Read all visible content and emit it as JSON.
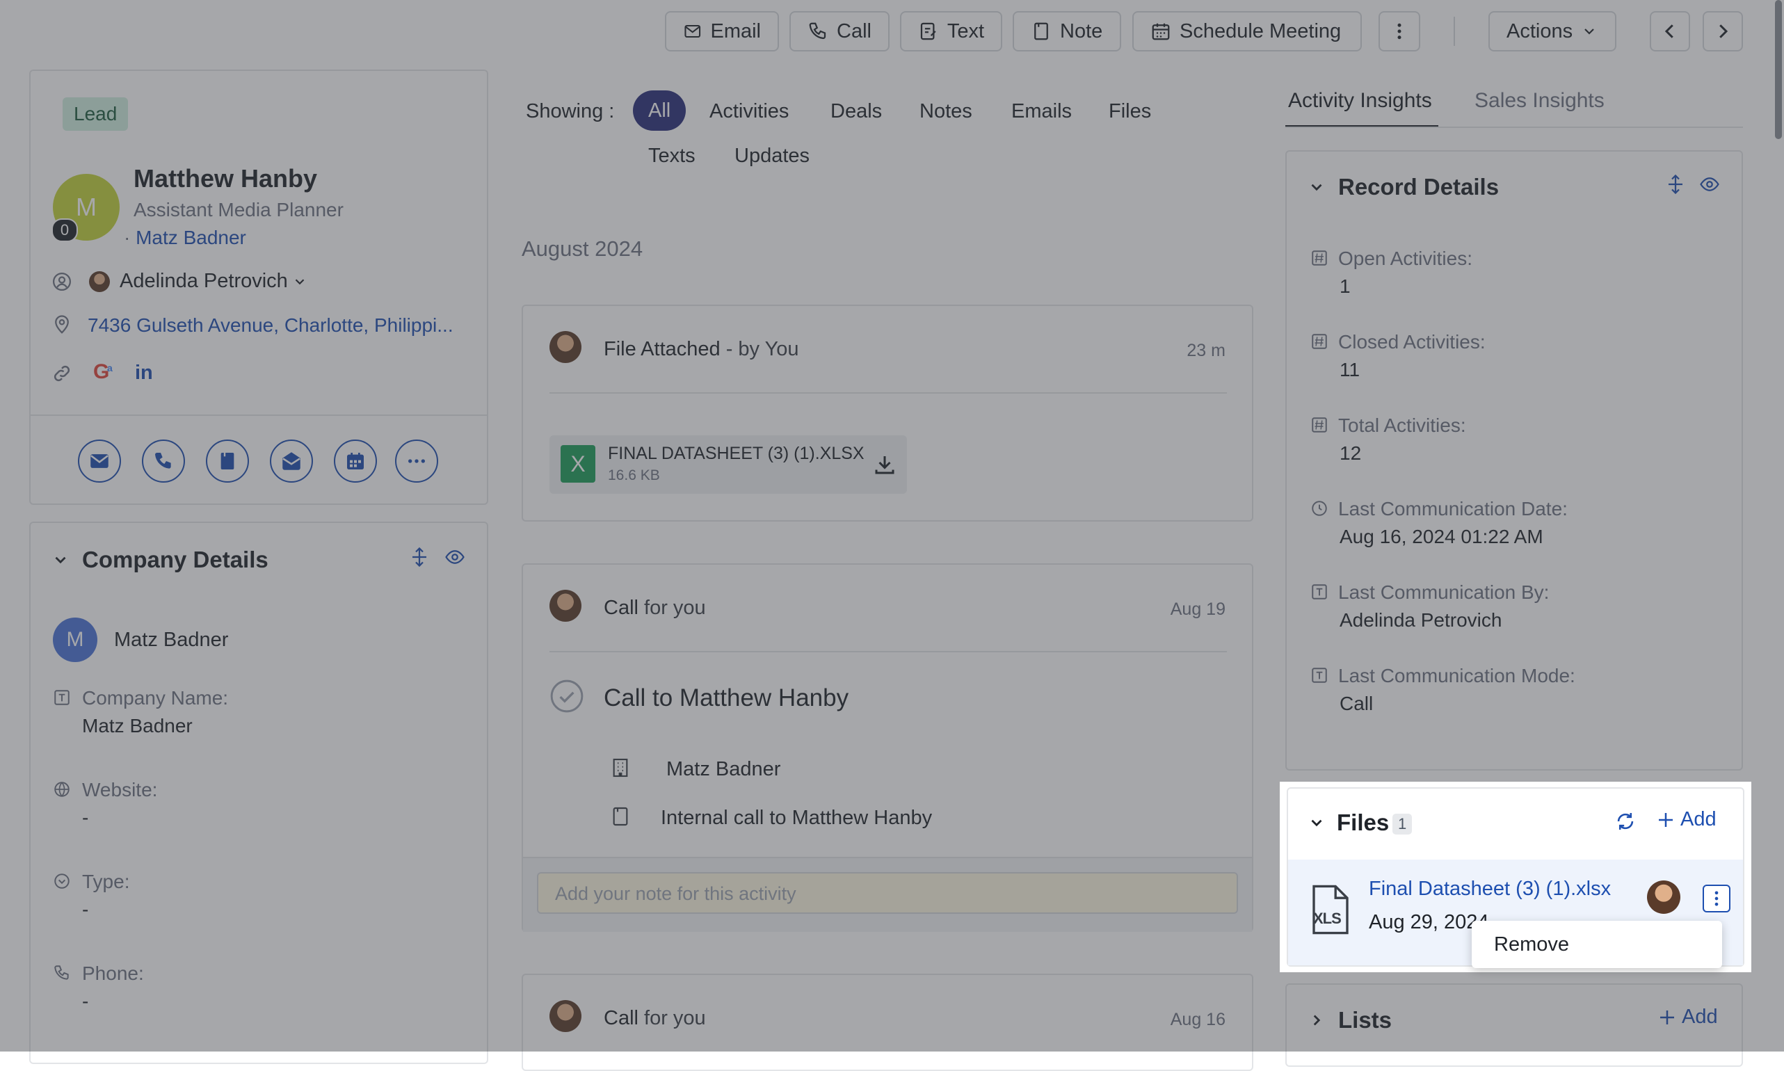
{
  "toolbar": {
    "email": "Email",
    "call": "Call",
    "text": "Text",
    "note": "Note",
    "schedule": "Schedule Meeting",
    "actions": "Actions"
  },
  "contact": {
    "badge": "Lead",
    "avatar_initial": "M",
    "avatar_count": "0",
    "name": "Matthew Hanby",
    "title": "Assistant Media Planner",
    "company_prefix": "·",
    "company": "Matz Badner",
    "owner": "Adelinda Petrovich",
    "address": "7436 Gulseth Avenue, Charlotte, Philippi..."
  },
  "company_details": {
    "heading": "Company Details",
    "avatar_initial": "M",
    "company": "Matz Badner",
    "fields": [
      {
        "label": "Company Name:",
        "value": "Matz Badner"
      },
      {
        "label": "Website:",
        "value": "-"
      },
      {
        "label": "Type:",
        "value": "-"
      },
      {
        "label": "Phone:",
        "value": "-"
      }
    ]
  },
  "feed": {
    "showing_label": "Showing :",
    "filters": [
      "All",
      "Activities",
      "Deals",
      "Notes",
      "Emails",
      "Files",
      "Texts",
      "Updates"
    ],
    "month": "August 2024",
    "file_card": {
      "title": "File Attached",
      "by": " - by You",
      "time": "23 m",
      "file_name": "FINAL DATASHEET (3) (1).XLSX",
      "file_size": "16.6 KB",
      "file_icon_letter": "X"
    },
    "call_card": {
      "title": "Call",
      "for": " for you",
      "date": "Aug 19",
      "subject": "Call to Matthew Hanby",
      "company": "Matz Badner",
      "description": "Internal call to Matthew Hanby",
      "note_placeholder": "Add your note for this activity"
    },
    "call_card2": {
      "title": "Call",
      "for": " for you",
      "date": "Aug 16"
    }
  },
  "insights": {
    "tabs": [
      "Activity Insights",
      "Sales Insights"
    ],
    "record_details": {
      "heading": "Record Details",
      "fields": [
        {
          "label": "Open Activities:",
          "value": "1"
        },
        {
          "label": "Closed Activities:",
          "value": "11"
        },
        {
          "label": "Total Activities:",
          "value": "12"
        },
        {
          "label": "Last Communication Date:",
          "value": "Aug 16, 2024 01:22 AM"
        },
        {
          "label": "Last Communication By:",
          "value": "Adelinda Petrovich"
        },
        {
          "label": "Last Communication Mode:",
          "value": "Call"
        }
      ]
    },
    "files": {
      "heading": "Files",
      "count": "1",
      "add": "Add",
      "file_name": "Final Datasheet (3) (1).xlsx",
      "file_date": "Aug 29, 2024",
      "file_icon_label": "XLS",
      "menu_remove": "Remove"
    },
    "lists": {
      "heading": "Lists",
      "add": "Add"
    }
  },
  "colors": {
    "accent": "#1e4fb0",
    "pill": "#2a2f7a",
    "lead_badge": "#cfeee0",
    "overlay": "rgba(60,64,70,0.46)"
  }
}
